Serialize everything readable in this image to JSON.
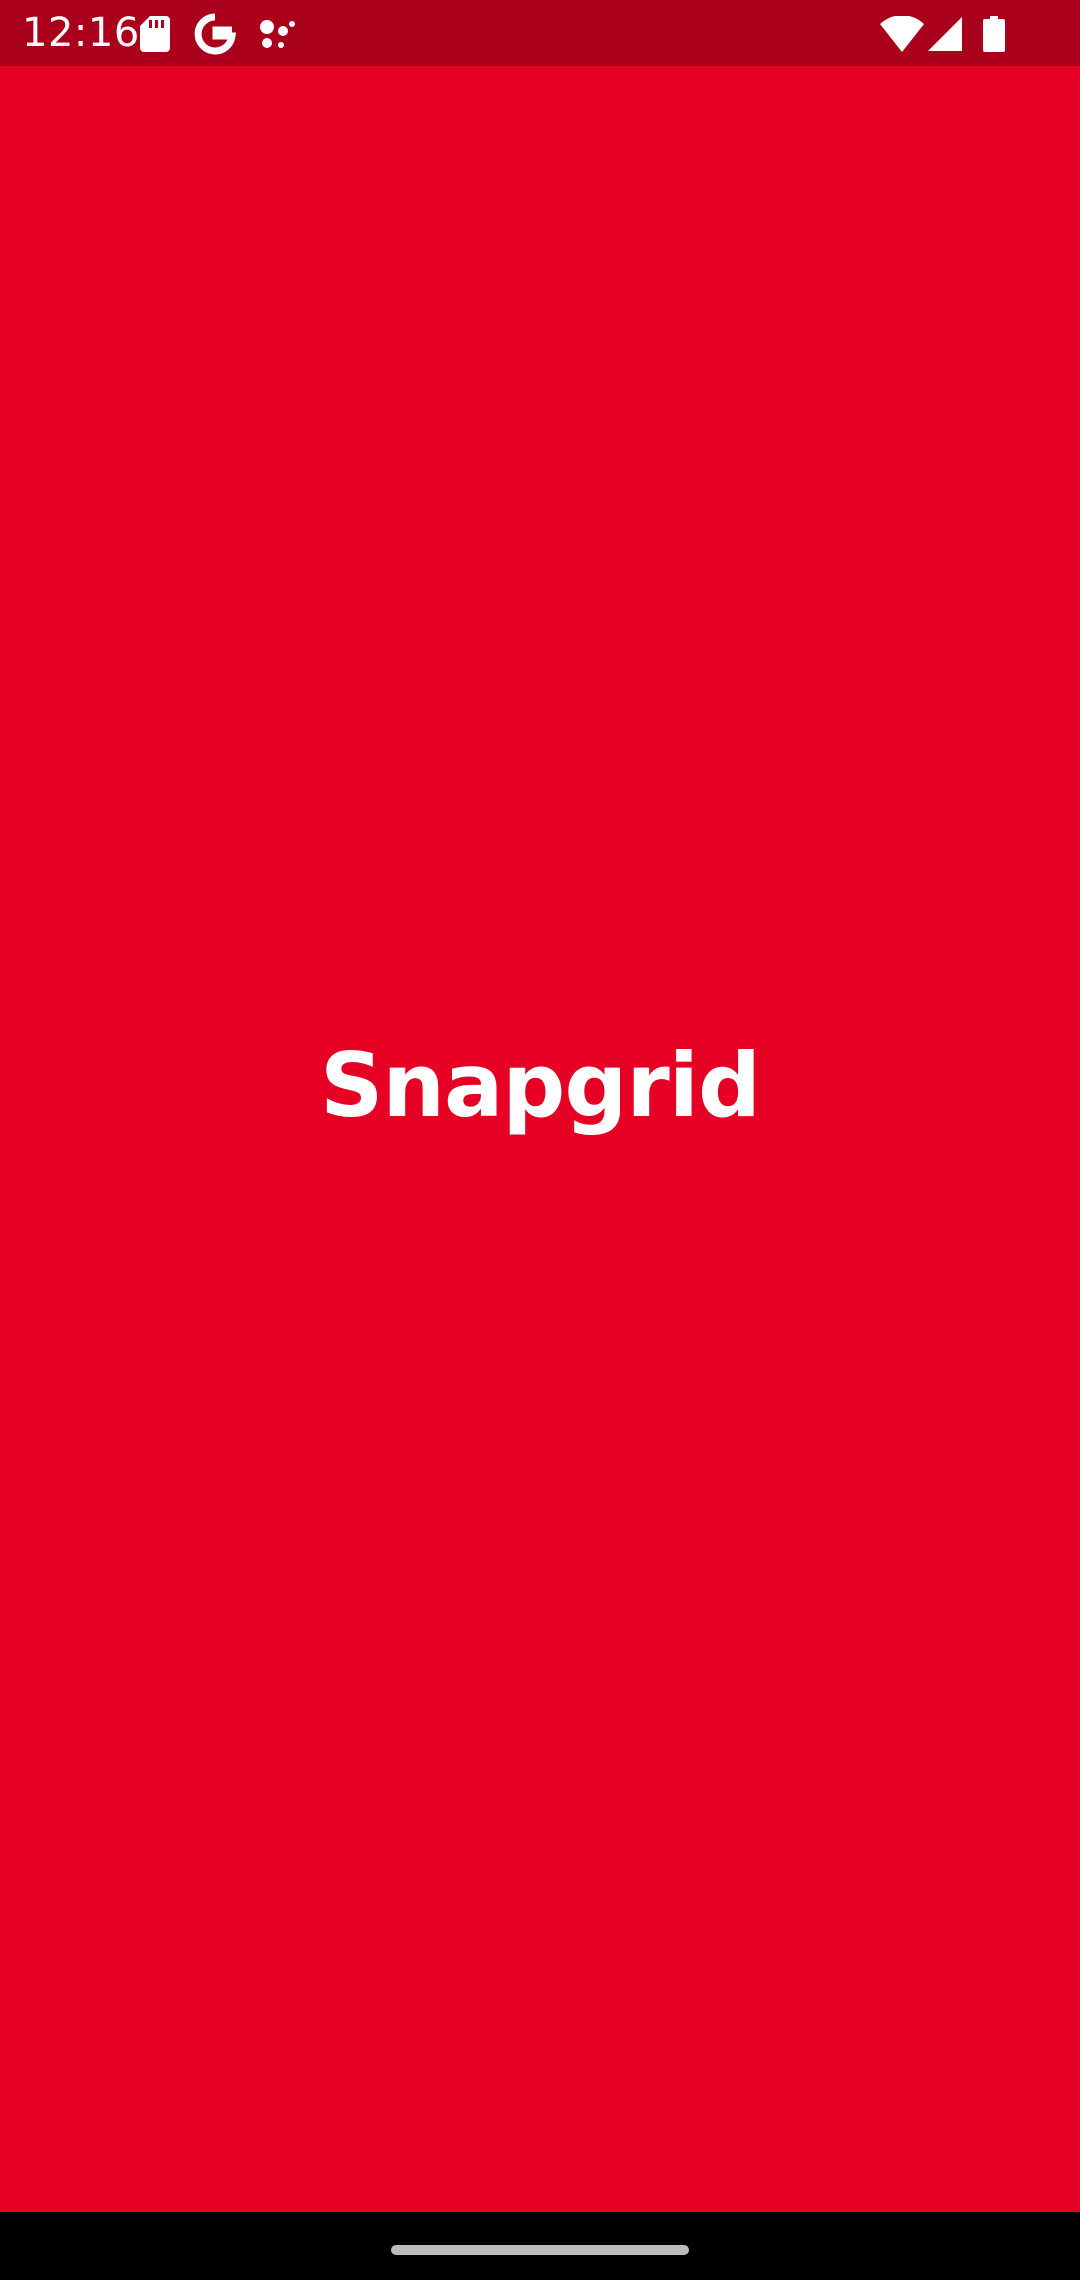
{
  "status_bar": {
    "time": "12:16",
    "left_icons": [
      "sd-card-icon",
      "google-g-icon",
      "dots-icon"
    ],
    "right_icons": [
      "wifi-icon",
      "signal-icon",
      "battery-icon"
    ],
    "background_color": "#AB001C"
  },
  "splash": {
    "title": "Snapgrid",
    "background_color": "#E50024",
    "text_color": "#FFFFFF"
  },
  "navigation": {
    "type": "gesture",
    "handle_icon": "home-handle"
  }
}
